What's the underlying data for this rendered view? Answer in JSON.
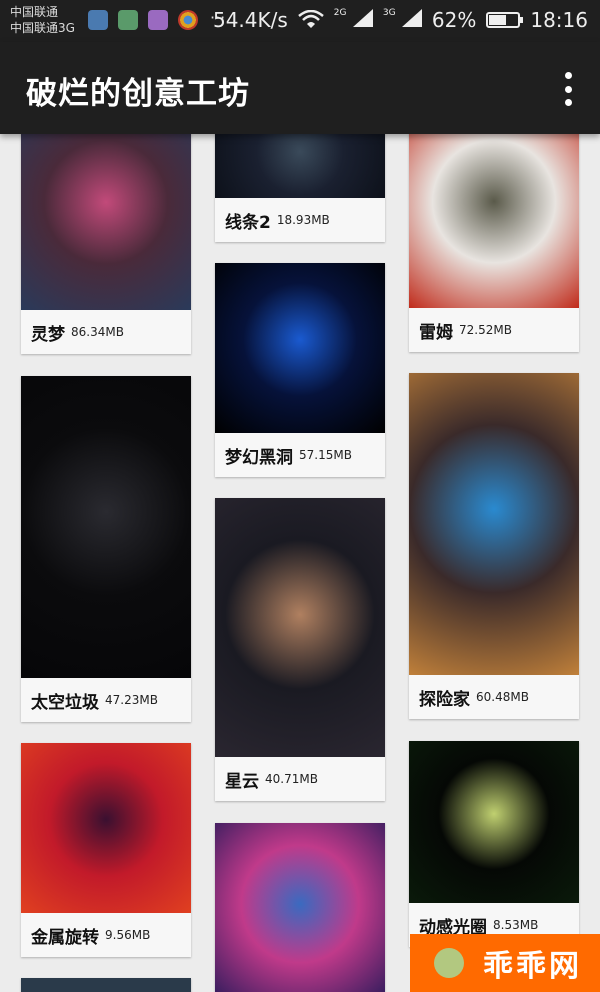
{
  "status": {
    "carrier1": "中国联通",
    "carrier2": "中国联通3G",
    "dots": "···",
    "speed": "54.4K/s",
    "net2g": "2G",
    "net3g": "3G",
    "battery": "62%",
    "battery_level": 0.62,
    "time": "18:16"
  },
  "appbar": {
    "title": "破烂的创意工坊",
    "menu_icon": "more-vert-icon"
  },
  "wallpapers": [
    {
      "name": "灵梦",
      "size": "86.34MB",
      "colors": [
        "#4a2a3a",
        "#c24a7a",
        "#2a3a5a"
      ]
    },
    {
      "name": "太空垃圾",
      "size": "47.23MB",
      "colors": [
        "#0b0b0d",
        "#2a2a30",
        "#060608"
      ]
    },
    {
      "name": "金属旋转",
      "size": "9.56MB",
      "colors": [
        "#c21a2a",
        "#3a1030",
        "#e04020"
      ]
    },
    {
      "name": "线条2",
      "size": "18.93MB",
      "colors": [
        "#1a2030",
        "#3a4a5a",
        "#0d111a"
      ]
    },
    {
      "name": "梦幻黑洞",
      "size": "57.15MB",
      "colors": [
        "#06123a",
        "#1a5ad0",
        "#000000"
      ]
    },
    {
      "name": "星云",
      "size": "40.71MB",
      "colors": [
        "#1a1a22",
        "#b08060",
        "#2a2630"
      ]
    },
    {
      "name": "",
      "size": "",
      "colors": [
        "#c03a8a",
        "#3a6ac0",
        "#2a1a5a"
      ]
    },
    {
      "name": "雷姆",
      "size": "72.52MB",
      "colors": [
        "#e8e4e0",
        "#5a5a4a",
        "#c02a1a"
      ]
    },
    {
      "name": "探险家",
      "size": "60.48MB",
      "colors": [
        "#3a2a2a",
        "#2a8ad0",
        "#c0803a"
      ]
    },
    {
      "name": "动感光圈",
      "size": "8.53MB",
      "colors": [
        "#050805",
        "#c0d070",
        "#0a1a0a"
      ]
    }
  ],
  "watermark": {
    "text": "乖乖网"
  }
}
